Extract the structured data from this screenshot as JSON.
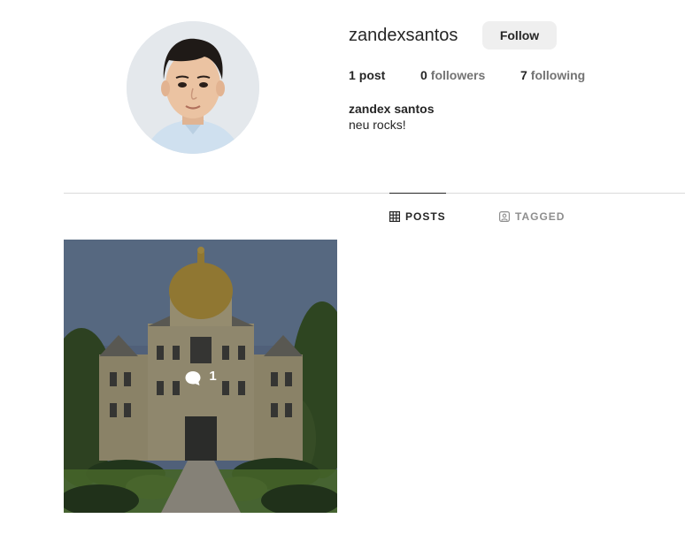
{
  "profile": {
    "username": "zandexsantos",
    "follow_label": "Follow",
    "full_name": "zandex santos",
    "bio": "neu rocks!",
    "avatar_icon": "profile-photo"
  },
  "stats": {
    "posts_count": "1",
    "posts_label": "post",
    "followers_count": "0",
    "followers_label": "followers",
    "following_count": "7",
    "following_label": "following"
  },
  "tabs": [
    {
      "label": "POSTS",
      "icon": "grid-icon",
      "active": true
    },
    {
      "label": "TAGGED",
      "icon": "tag-icon",
      "active": false
    }
  ],
  "posts": [
    {
      "comment_count": "1",
      "icon": "comment-icon",
      "image": "building-photo"
    }
  ],
  "colors": {
    "text": "#262626",
    "muted": "#737373",
    "tab_inactive": "#8e8e8e",
    "divider": "#dbdbdb",
    "button_bg": "#efefef"
  }
}
